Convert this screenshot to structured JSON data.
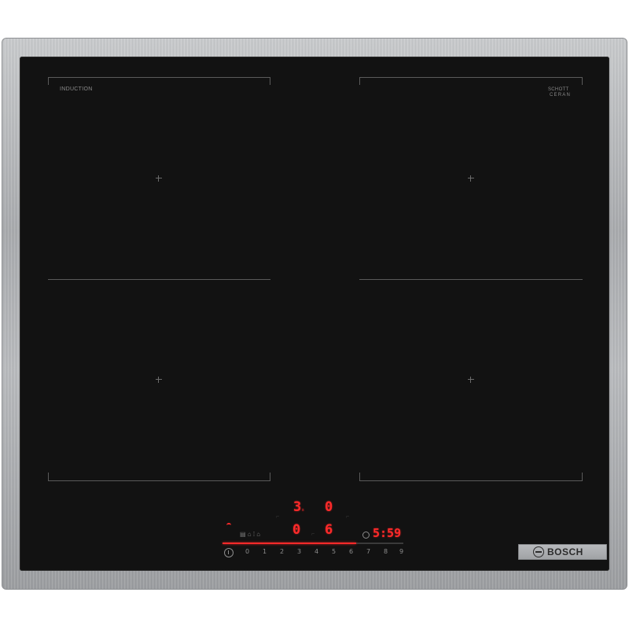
{
  "cooktop": {
    "labels": {
      "induction": "INDUCTION",
      "schott": "SCHOTT",
      "ceran": "CERAN"
    },
    "display": {
      "top_left_digit": "3",
      "top_left_sub": "s",
      "top_right_digit": "0",
      "bottom_left_digit": "0",
      "bottom_right_digit": "6",
      "timer_value": "5:59"
    },
    "slider": {
      "level_fraction": 0.74
    },
    "scale": [
      "0",
      "1",
      "2",
      "3",
      "4",
      "5",
      "6",
      "7",
      "8",
      "9"
    ],
    "brand": {
      "name": "BOSCH"
    }
  },
  "icons": [
    "wifi-icon",
    "power-icon",
    "clock-icon",
    "crosshair-icon",
    "bosch-logo-icon"
  ],
  "colors": {
    "glass": "#121212",
    "display_red": "#ff2a2a",
    "frame_steel": "#b0b2b5"
  }
}
